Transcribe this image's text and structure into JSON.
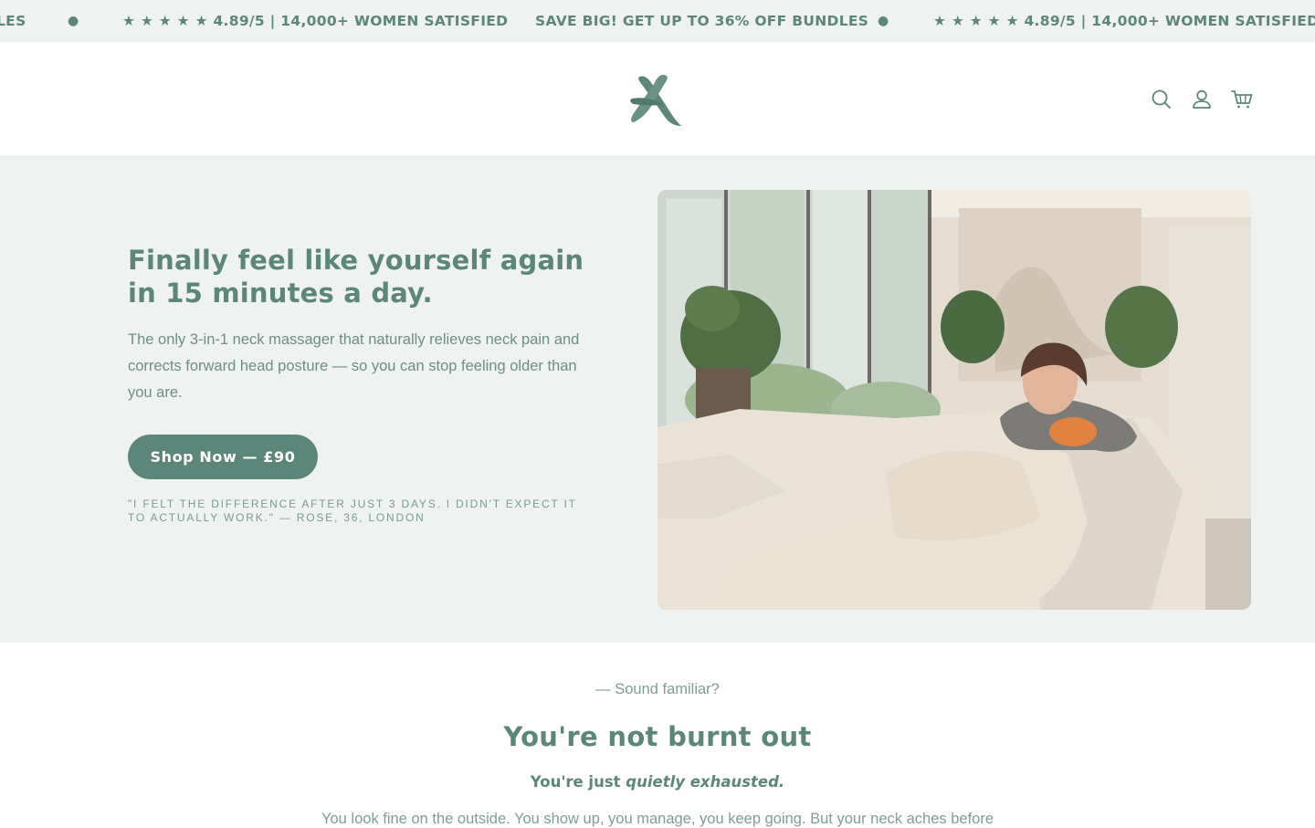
{
  "announcement": {
    "items": [
      "★ ★ ★ ★ ★ 4.89/5 | 14,000+ WOMEN SATISFIED",
      "SAVE BIG! GET UP TO 36% OFF BUNDLES",
      "★ ★ ★ ★ ★ 4.89/5 | 14,000+ WOMEN SATISFIED",
      "LES"
    ],
    "separator": "●"
  },
  "header": {
    "logo_icon": "x-brush-logo",
    "icons": [
      "search-icon",
      "account-icon",
      "cart-icon"
    ]
  },
  "hero": {
    "title": "Finally feel like yourself again in 15 minutes a day.",
    "subtitle": "The only 3-in-1 neck massager that naturally relieves neck pain and corrects forward head posture — so you can stop feeling older than you are.",
    "cta_label": "Shop Now — £90",
    "quote": "\"I FELT THE DIFFERENCE AFTER JUST 3 DAYS. I DIDN'T EXPECT IT TO ACTUALLY WORK.\" — ROSE, 36, LONDON",
    "image_alt": "Woman relaxing on a sofa using a heated neck massager"
  },
  "section": {
    "eyebrow": "—   Sound familiar?",
    "title": "You're not burnt out",
    "subtitle_prefix": "You're just ",
    "subtitle_emphasis": "quietly exhausted.",
    "body": "You look fine on the outside. You show up, you manage, you keep going. But your neck aches before"
  },
  "colors": {
    "brand": "#5c867a",
    "announcement_bg": "#eef2f1",
    "hero_bg": "#eef2f1",
    "page_bg": "#ffffff"
  }
}
